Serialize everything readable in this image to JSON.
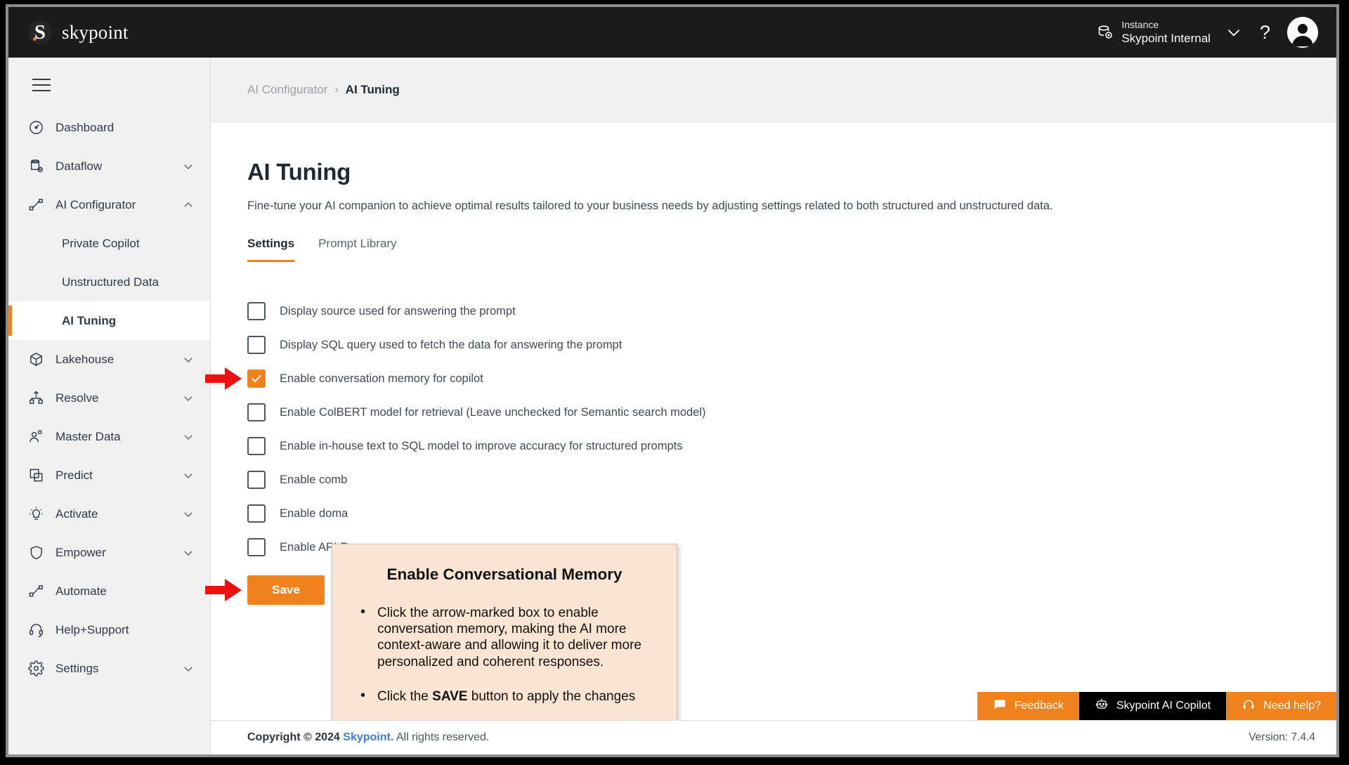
{
  "topbar": {
    "brand_letter": "S",
    "brand_name": "skypoint",
    "instance_label": "Instance",
    "instance_value": "Skypoint Internal",
    "help_glyph": "?",
    "icons": {
      "instance": "instance-icon",
      "chevron": "chevron-down-icon",
      "avatar": "avatar-icon"
    }
  },
  "sidebar": {
    "items": [
      {
        "label": "Dashboard",
        "icon": "dashboard-icon",
        "expandable": false,
        "expanded": false
      },
      {
        "label": "Dataflow",
        "icon": "dataflow-icon",
        "expandable": true,
        "expanded": false
      },
      {
        "label": "AI Configurator",
        "icon": "ai-configurator-icon",
        "expandable": true,
        "expanded": true
      },
      {
        "label": "Lakehouse",
        "icon": "lakehouse-icon",
        "expandable": true,
        "expanded": false
      },
      {
        "label": "Resolve",
        "icon": "resolve-icon",
        "expandable": true,
        "expanded": false
      },
      {
        "label": "Master Data",
        "icon": "master-data-icon",
        "expandable": true,
        "expanded": false
      },
      {
        "label": "Predict",
        "icon": "predict-icon",
        "expandable": true,
        "expanded": false
      },
      {
        "label": "Activate",
        "icon": "activate-icon",
        "expandable": true,
        "expanded": false
      },
      {
        "label": "Empower",
        "icon": "empower-icon",
        "expandable": true,
        "expanded": false
      },
      {
        "label": "Automate",
        "icon": "automate-icon",
        "expandable": false,
        "expanded": false
      },
      {
        "label": "Help+Support",
        "icon": "help-support-icon",
        "expandable": false,
        "expanded": false
      },
      {
        "label": "Settings",
        "icon": "settings-icon",
        "expandable": true,
        "expanded": false
      }
    ],
    "sub_items": [
      {
        "label": "Private Copilot",
        "active": false
      },
      {
        "label": "Unstructured Data",
        "active": false
      },
      {
        "label": "AI Tuning",
        "active": true
      }
    ]
  },
  "breadcrumb": {
    "parent": "AI Configurator",
    "separator": "›",
    "current": "AI Tuning"
  },
  "page": {
    "title": "AI Tuning",
    "description": "Fine-tune your AI companion to achieve optimal results tailored to your business needs by adjusting settings related to both structured and unstructured data.",
    "tabs": [
      {
        "label": "Settings",
        "active": true
      },
      {
        "label": "Prompt Library",
        "active": false
      }
    ],
    "checkboxes": [
      {
        "label": "Display source used for answering the prompt",
        "checked": false
      },
      {
        "label": "Display SQL query used to fetch the data for answering the prompt",
        "checked": false
      },
      {
        "label": "Enable conversation memory for copilot",
        "checked": true
      },
      {
        "label": "Enable ColBERT model for retrieval (Leave unchecked for Semantic search model)",
        "checked": false
      },
      {
        "label": "Enable in-house text to SQL model to improve accuracy for structured prompts",
        "checked": false
      },
      {
        "label": "Enable comb",
        "checked": false
      },
      {
        "label": "Enable doma",
        "checked": false
      },
      {
        "label": "Enable API Re",
        "checked": false
      }
    ],
    "save_label": "Save"
  },
  "callout": {
    "title": "Enable Conversational Memory",
    "bullet1": "Click the arrow-marked box to enable conversation memory, making the AI more context-aware and allowing it to deliver more personalized and coherent responses.",
    "bullet2_pre": "Click the ",
    "bullet2_bold": "SAVE",
    "bullet2_post": " button to apply the changes"
  },
  "action_strip": [
    {
      "label": "Feedback",
      "icon": "feedback-icon",
      "style": "orange"
    },
    {
      "label": "Skypoint AI Copilot",
      "icon": "robot-icon",
      "style": "black"
    },
    {
      "label": "Need help?",
      "icon": "headset-icon",
      "style": "orange"
    }
  ],
  "footer": {
    "copyright_pre": "Copyright © 2024 ",
    "brand": "Skypoint.",
    "copyright_post": " All rights reserved.",
    "version": "Version: 7.4.4"
  },
  "colors": {
    "accent_orange": "#f0821e",
    "topbar_dark": "#1b1b1b",
    "sidebar_bg": "#f0f0f0",
    "callout_bg": "#fae5d3",
    "arrow_red": "#ee1111",
    "link_blue": "#3b7dd8"
  }
}
